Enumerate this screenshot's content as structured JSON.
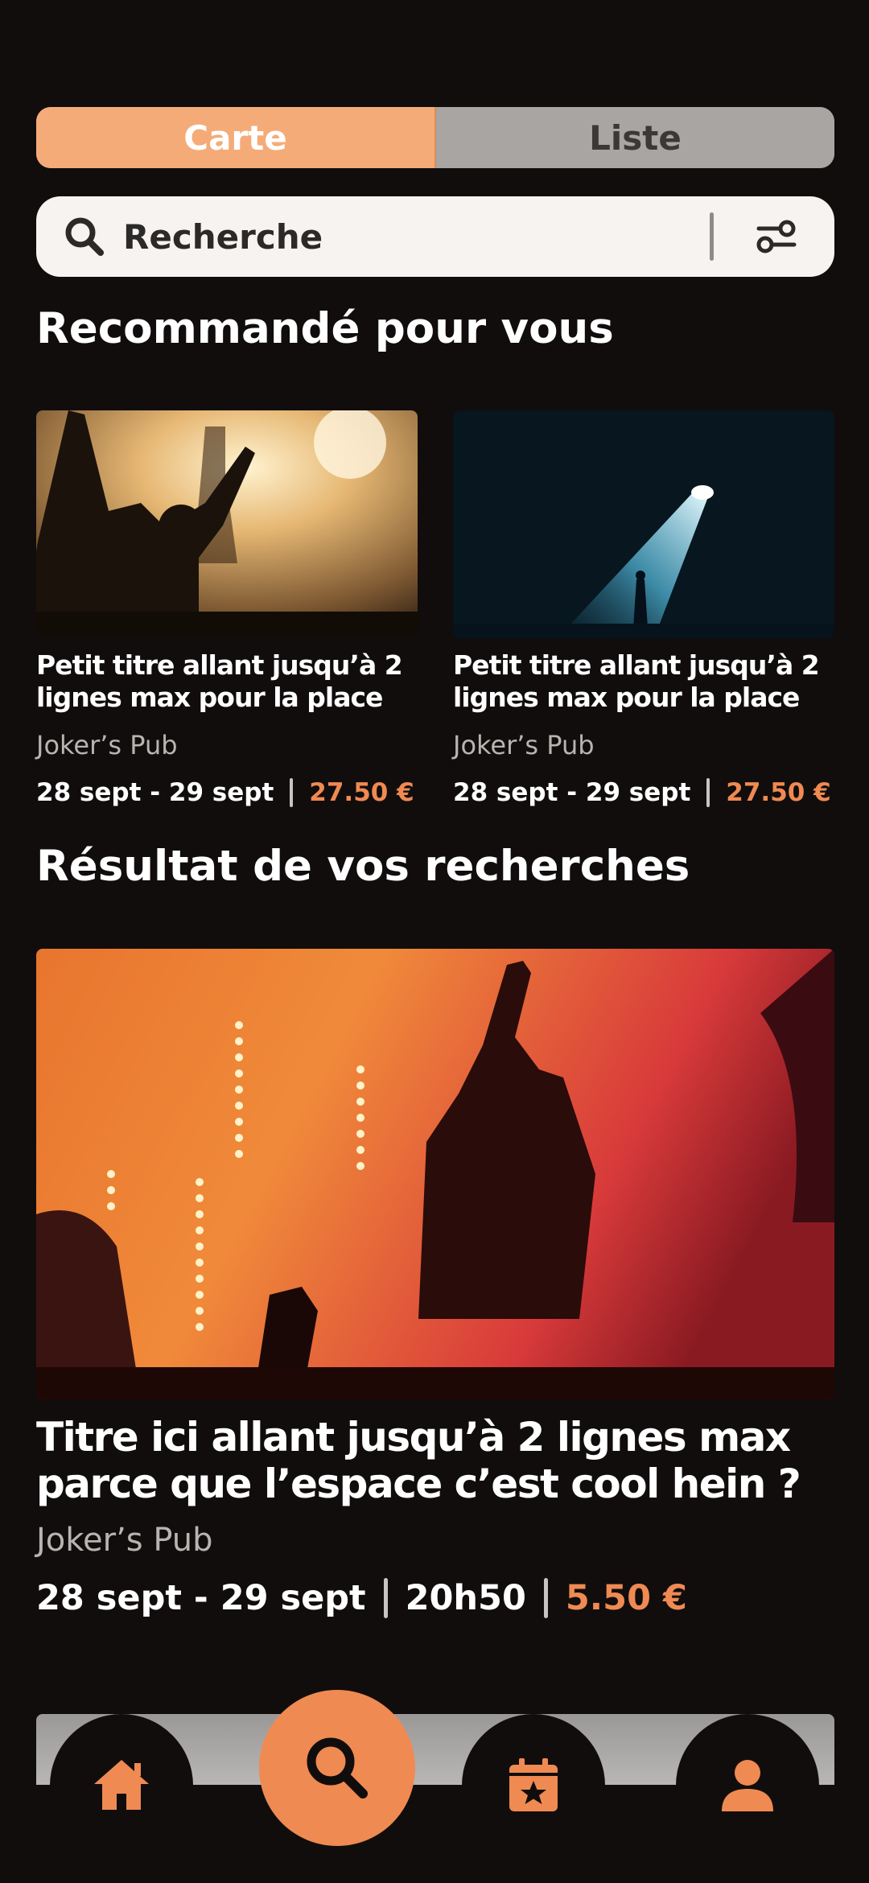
{
  "view_toggle": {
    "map_label": "Carte",
    "list_label": "Liste",
    "active": "Carte"
  },
  "search": {
    "placeholder": "Recherche"
  },
  "sections": {
    "recommended_title": "Recommandé pour vous",
    "results_title": "Résultat de vos recherches"
  },
  "recommended": [
    {
      "title": "Petit titre allant jusqu’à 2 lignes max pour la place",
      "venue": "Joker’s Pub",
      "dates": "28 sept - 29 sept",
      "price": "27.50 €"
    },
    {
      "title": "Petit titre allant jusqu’à 2 lignes max pour la place",
      "venue": "Joker’s Pub",
      "dates": "28 sept - 29 sept",
      "price": "27.50 €"
    }
  ],
  "results": [
    {
      "title": "Titre ici allant jusqu’à 2 lignes max parce que l’espace c’est cool hein ?",
      "venue": "Joker’s Pub",
      "dates": "28 sept - 29 sept",
      "time": "20h50",
      "price": "5.50 €"
    }
  ],
  "nav": {
    "items": [
      "home-icon",
      "search-icon",
      "calendar-star-icon",
      "profile-icon"
    ],
    "active": "search-icon"
  },
  "colors": {
    "accent": "#ef8a52",
    "toggle_active": "#f5ab78",
    "toggle_inactive": "#a8a5a3",
    "background": "#110d0d"
  }
}
